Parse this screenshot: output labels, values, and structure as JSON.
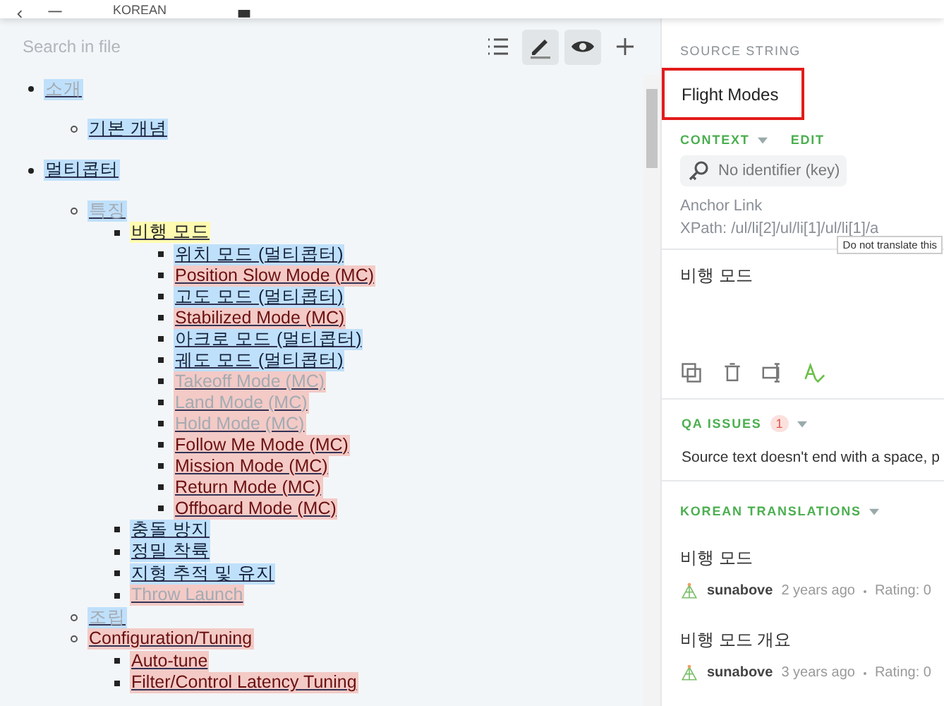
{
  "top_bar": {
    "language": "KOREAN"
  },
  "search": {
    "placeholder": "Search in file"
  },
  "toolbar": [
    {
      "kind": "list",
      "selected": false
    },
    {
      "kind": "edit",
      "selected": true
    },
    {
      "kind": "preview",
      "selected": true
    },
    {
      "kind": "add",
      "selected": false
    }
  ],
  "tree": [
    {
      "text": "소개",
      "translated": true,
      "hidden": true,
      "selected": false,
      "children": [
        {
          "text": "기본 개념",
          "translated": true,
          "hidden": false,
          "selected": false
        }
      ]
    },
    {
      "text": "멀티콥터",
      "translated": true,
      "hidden": false,
      "selected": false,
      "children": [
        {
          "text": "특징",
          "translated": true,
          "hidden": true,
          "selected": false,
          "children": [
            {
              "text": "비행 모드",
              "translated": true,
              "hidden": false,
              "selected": true,
              "children": [
                {
                  "text": "위치 모드 (멀티콥터)",
                  "translated": true,
                  "hidden": false,
                  "selected": false
                },
                {
                  "text": "Position Slow Mode (MC)",
                  "translated": false,
                  "hidden": false,
                  "selected": false
                },
                {
                  "text": "고도 모드 (멀티콥터)",
                  "translated": true,
                  "hidden": false,
                  "selected": false
                },
                {
                  "text": "Stabilized Mode (MC)",
                  "translated": false,
                  "hidden": false,
                  "selected": false
                },
                {
                  "text": "아크로 모드 (멀티콥터)",
                  "translated": true,
                  "hidden": false,
                  "selected": false
                },
                {
                  "text": "궤도 모드 (멀티콥터)",
                  "translated": true,
                  "hidden": false,
                  "selected": false
                },
                {
                  "text": "Takeoff Mode (MC)",
                  "translated": false,
                  "hidden": true,
                  "selected": false
                },
                {
                  "text": "Land Mode (MC)",
                  "translated": false,
                  "hidden": true,
                  "selected": false
                },
                {
                  "text": "Hold Mode (MC)",
                  "translated": false,
                  "hidden": true,
                  "selected": false
                },
                {
                  "text": "Follow Me Mode (MC)",
                  "translated": false,
                  "hidden": false,
                  "selected": false
                },
                {
                  "text": "Mission Mode (MC)",
                  "translated": false,
                  "hidden": false,
                  "selected": false
                },
                {
                  "text": "Return Mode (MC)",
                  "translated": false,
                  "hidden": false,
                  "selected": false
                },
                {
                  "text": "Offboard Mode (MC)",
                  "translated": false,
                  "hidden": false,
                  "selected": false
                }
              ]
            },
            {
              "text": "충돌 방지",
              "translated": true,
              "hidden": false,
              "selected": false
            },
            {
              "text": "정밀 착륙",
              "translated": true,
              "hidden": false,
              "selected": false
            },
            {
              "text": "지형 추적 및 유지",
              "translated": true,
              "hidden": false,
              "selected": false
            },
            {
              "text": "Throw Launch",
              "translated": false,
              "hidden": true,
              "selected": false
            }
          ]
        },
        {
          "text": "조립",
          "translated": true,
          "hidden": true,
          "selected": false
        },
        {
          "text": "Configuration/Tuning",
          "translated": false,
          "hidden": false,
          "selected": false,
          "children": [
            {
              "text": "Auto-tune",
              "translated": false,
              "hidden": false,
              "selected": false
            },
            {
              "text": "Filter/Control Latency Tuning",
              "translated": false,
              "hidden": false,
              "selected": false
            }
          ]
        }
      ]
    }
  ],
  "source": {
    "heading": "SOURCE STRING",
    "text": "Flight Modes",
    "context_label": "CONTEXT",
    "edit_label": "EDIT",
    "key": "No identifier (key)",
    "anchor": "Anchor Link",
    "xpath": "XPath: /ul/li[2]/ul/li[1]/ul/li[1]/a",
    "tooltip": "Do not translate this"
  },
  "translation_input": {
    "value": "비행 모드"
  },
  "editor_tools": [
    {
      "kind": "copy"
    },
    {
      "kind": "delete"
    },
    {
      "kind": "cursor"
    },
    {
      "kind": "spellcheck"
    }
  ],
  "qa": {
    "heading": "QA ISSUES",
    "count": "1",
    "message": "Source text doesn't end with a space, p"
  },
  "translations": {
    "heading": "KOREAN TRANSLATIONS",
    "items": [
      {
        "text": "비행 모드",
        "user": "sunabove",
        "time": "2 years ago",
        "rating": "Rating: 0"
      },
      {
        "text": "비행 모드 개요",
        "user": "sunabove",
        "time": "3 years ago",
        "rating": "Rating: 0"
      }
    ]
  }
}
